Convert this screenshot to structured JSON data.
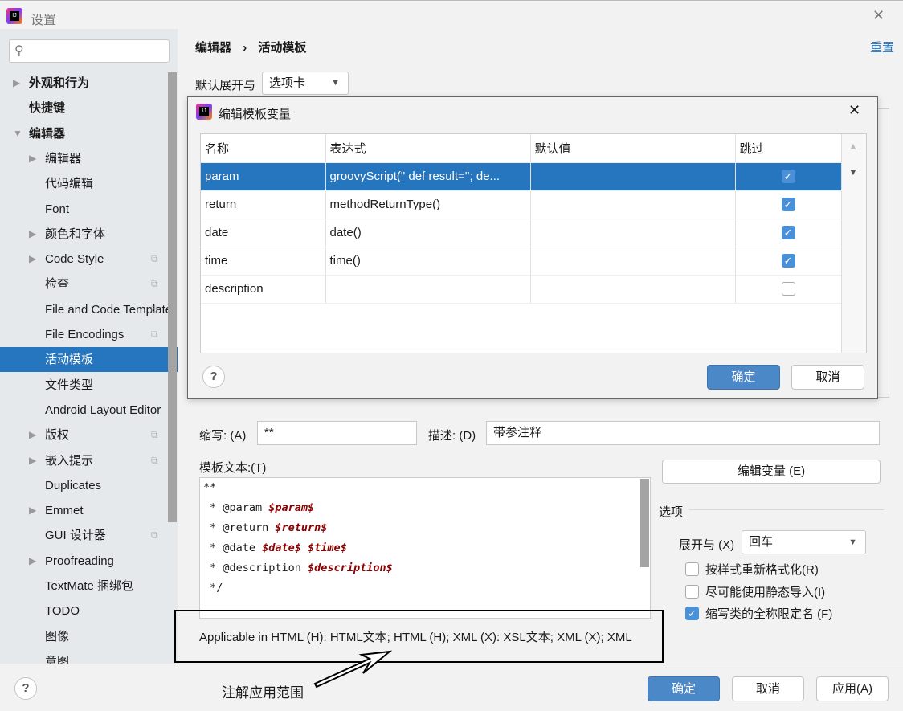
{
  "window": {
    "title": "设置",
    "close": "✕"
  },
  "sidebar": {
    "items": [
      {
        "label": "外观和行为",
        "bold": true,
        "arrow": "▶"
      },
      {
        "label": "快捷键",
        "bold": true
      },
      {
        "label": "编辑器",
        "bold": true,
        "arrow": "▼"
      },
      {
        "label": "编辑器",
        "arrow": "▶"
      },
      {
        "label": "代码编辑"
      },
      {
        "label": "Font"
      },
      {
        "label": "颜色和字体",
        "arrow": "▶"
      },
      {
        "label": "Code Style",
        "arrow": "▶",
        "copy": true
      },
      {
        "label": "检查",
        "copy": true
      },
      {
        "label": "File and Code Templates",
        "copy": true
      },
      {
        "label": "File Encodings",
        "copy": true
      },
      {
        "label": "活动模板",
        "selected": true
      },
      {
        "label": "文件类型"
      },
      {
        "label": "Android Layout Editor"
      },
      {
        "label": "版权",
        "arrow": "▶",
        "copy": true
      },
      {
        "label": "嵌入提示",
        "arrow": "▶",
        "copy": true
      },
      {
        "label": "Duplicates"
      },
      {
        "label": "Emmet",
        "arrow": "▶"
      },
      {
        "label": "GUI 设计器",
        "copy": true
      },
      {
        "label": "Proofreading",
        "arrow": "▶"
      },
      {
        "label": "TextMate 捆绑包"
      },
      {
        "label": "TODO"
      },
      {
        "label": "图像"
      },
      {
        "label": "意图"
      }
    ]
  },
  "breadcrumb": {
    "parent": "编辑器",
    "sep": "›",
    "current": "活动模板"
  },
  "reset": "重置",
  "expand_default": {
    "label": "默认展开与",
    "value": "选项卡"
  },
  "dialog": {
    "title": "编辑模板变量",
    "columns": [
      "名称",
      "表达式",
      "默认值",
      "跳过"
    ],
    "rows": [
      {
        "name": "param",
        "expr": "groovyScript(\" def result='';   de...",
        "default": "",
        "skip": true,
        "selected": true
      },
      {
        "name": "return",
        "expr": "methodReturnType()",
        "default": "",
        "skip": true
      },
      {
        "name": "date",
        "expr": "date()",
        "default": "",
        "skip": true
      },
      {
        "name": "time",
        "expr": "time()",
        "default": "",
        "skip": true
      },
      {
        "name": "description",
        "expr": "",
        "default": "",
        "skip": false
      }
    ],
    "ok": "确定",
    "cancel": "取消",
    "help": "?"
  },
  "abbrev": {
    "label": "缩写: (A)",
    "value": "**"
  },
  "desc": {
    "label": "描述: (D)",
    "value": "带参注释"
  },
  "template_text_label": "模板文本:(T)",
  "template_lines": [
    {
      "text": "**",
      "var": ""
    },
    {
      "text": " * @param ",
      "var": "$param$"
    },
    {
      "text": " * @return ",
      "var": "$return$"
    },
    {
      "text": " * @date ",
      "var": "$date$ $time$"
    },
    {
      "text": " * @description ",
      "var": "$description$"
    },
    {
      "text": " */",
      "var": ""
    }
  ],
  "edit_vars": "编辑变量 (E)",
  "options": {
    "title": "选项",
    "expand_label": "展开与 (X)",
    "expand_value": "回车",
    "checks": [
      {
        "label": "按样式重新格式化(R)",
        "checked": false
      },
      {
        "label": "尽可能使用静态导入(I)",
        "checked": false
      },
      {
        "label": "缩写类的全称限定名 (F)",
        "checked": true
      }
    ]
  },
  "applicable": "Applicable in HTML (H): HTML文本; HTML (H); XML (X): XSL文本; XML (X); XML",
  "annotation": "注解应用范围",
  "footer": {
    "ok": "确定",
    "cancel": "取消",
    "apply": "应用(A)",
    "help": "?"
  },
  "colors": {
    "accent": "#2675bf",
    "primary_button": "#4a88c7",
    "variable": "#8b0000"
  }
}
